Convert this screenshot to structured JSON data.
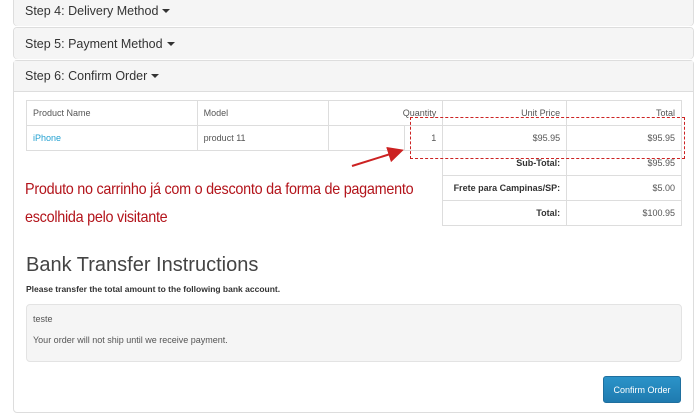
{
  "steps": [
    {
      "label": "Step 4: Delivery Method"
    },
    {
      "label": "Step 5: Payment Method"
    },
    {
      "label": "Step 6: Confirm Order"
    }
  ],
  "order_table": {
    "headers": [
      "Product Name",
      "Model",
      "Quantity",
      "Unit Price",
      "Total"
    ],
    "rows": [
      {
        "name": "iPhone",
        "model": "product 11",
        "quantity": "1",
        "unit_price": "$95.95",
        "total": "$95.95"
      }
    ],
    "totals": [
      {
        "label": "Sub-Total:",
        "value": "$95.95"
      },
      {
        "label": "Frete para Campinas/SP:",
        "value": "$5.00"
      },
      {
        "label": "Total:",
        "value": "$100.95"
      }
    ]
  },
  "annotation": {
    "line1": "Produto no carrinho já com o desconto da forma de pagamento",
    "line2": "escolhida pelo visitante",
    "color": "#b3141b"
  },
  "bank": {
    "title": "Bank Transfer Instructions",
    "subtitle": "Please transfer the total amount to the following bank account.",
    "account_text": "teste",
    "notice": "Your order will not ship until we receive payment."
  },
  "confirm_button": {
    "label": "Confirm Order",
    "color": "#2a8bc1"
  }
}
